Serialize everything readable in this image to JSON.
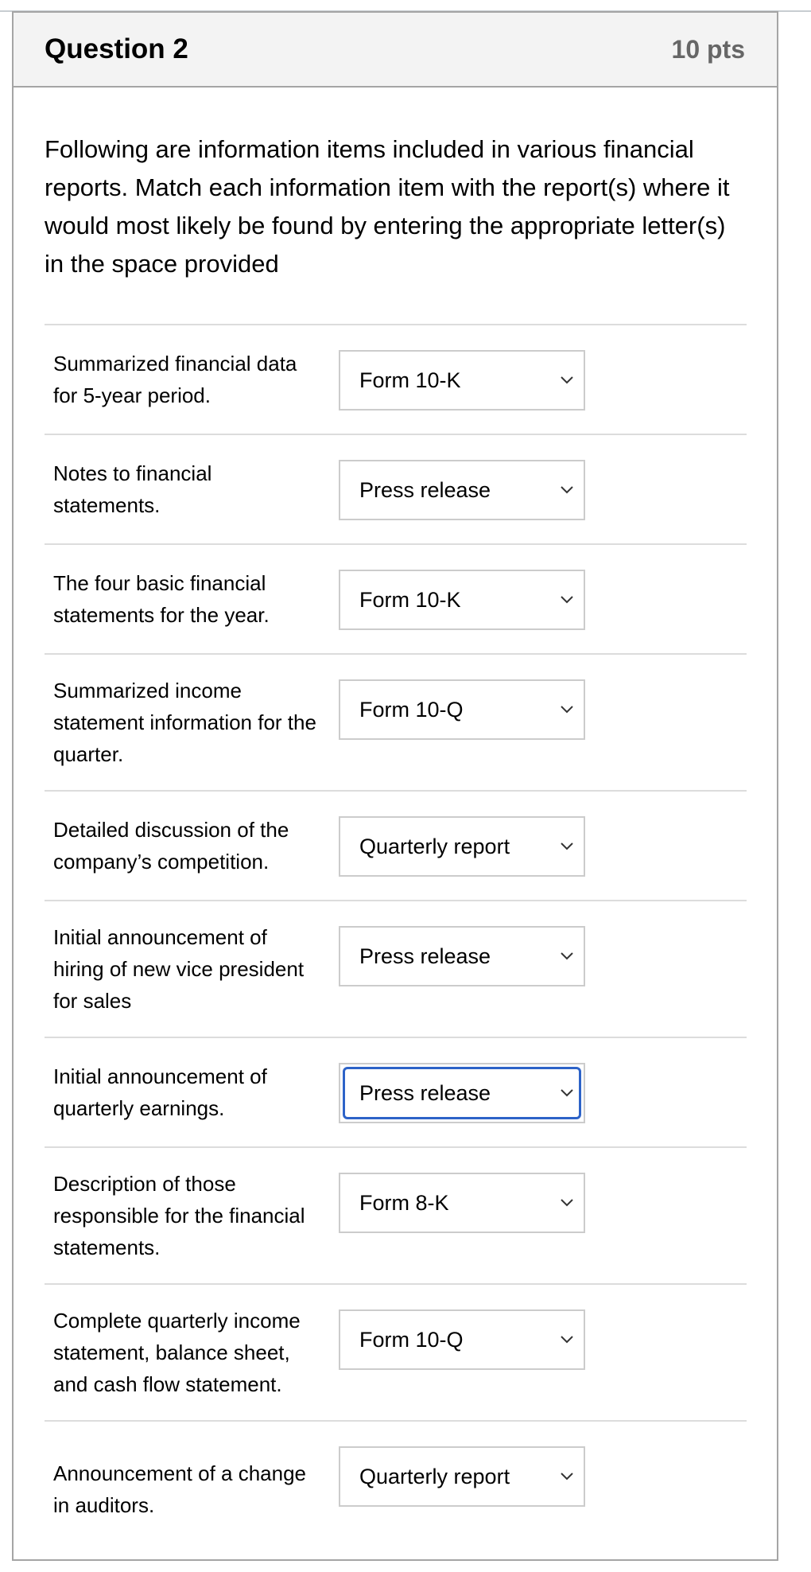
{
  "question": {
    "title": "Question 2",
    "points": "10 pts",
    "prompt": "Following are information items included in various financial reports. Match each information item with the report(s) where it would most likely be found by entering the appropriate letter(s) in the space provided"
  },
  "items": [
    {
      "label": "Summarized financial data for 5-year period.",
      "selected": "Form 10-K"
    },
    {
      "label": "Notes to financial statements.",
      "selected": "Press release"
    },
    {
      "label": "The four basic financial statements for the year.",
      "selected": "Form 10-K"
    },
    {
      "label": "Summarized income statement information for the quarter.",
      "selected": "Form 10-Q"
    },
    {
      "label": "Detailed discussion of the company’s competition.",
      "selected": "Quarterly report"
    },
    {
      "label": "Initial announcement of hiring of new vice president for sales",
      "selected": "Press release"
    },
    {
      "label": "Initial announcement of quarterly earnings.",
      "selected": "Press release",
      "focused": true
    },
    {
      "label": "Description of those responsible for the financial statements.",
      "selected": "Form 8-K"
    },
    {
      "label": "Complete quarterly income statement, balance sheet, and cash flow statement.",
      "selected": "Form 10-Q"
    },
    {
      "label": "Announcement of a change in auditors.",
      "selected": "Quarterly report"
    }
  ],
  "colors": {
    "focus": "#2d63c8",
    "header_bg": "#f3f3f3",
    "points_text": "#666666"
  }
}
